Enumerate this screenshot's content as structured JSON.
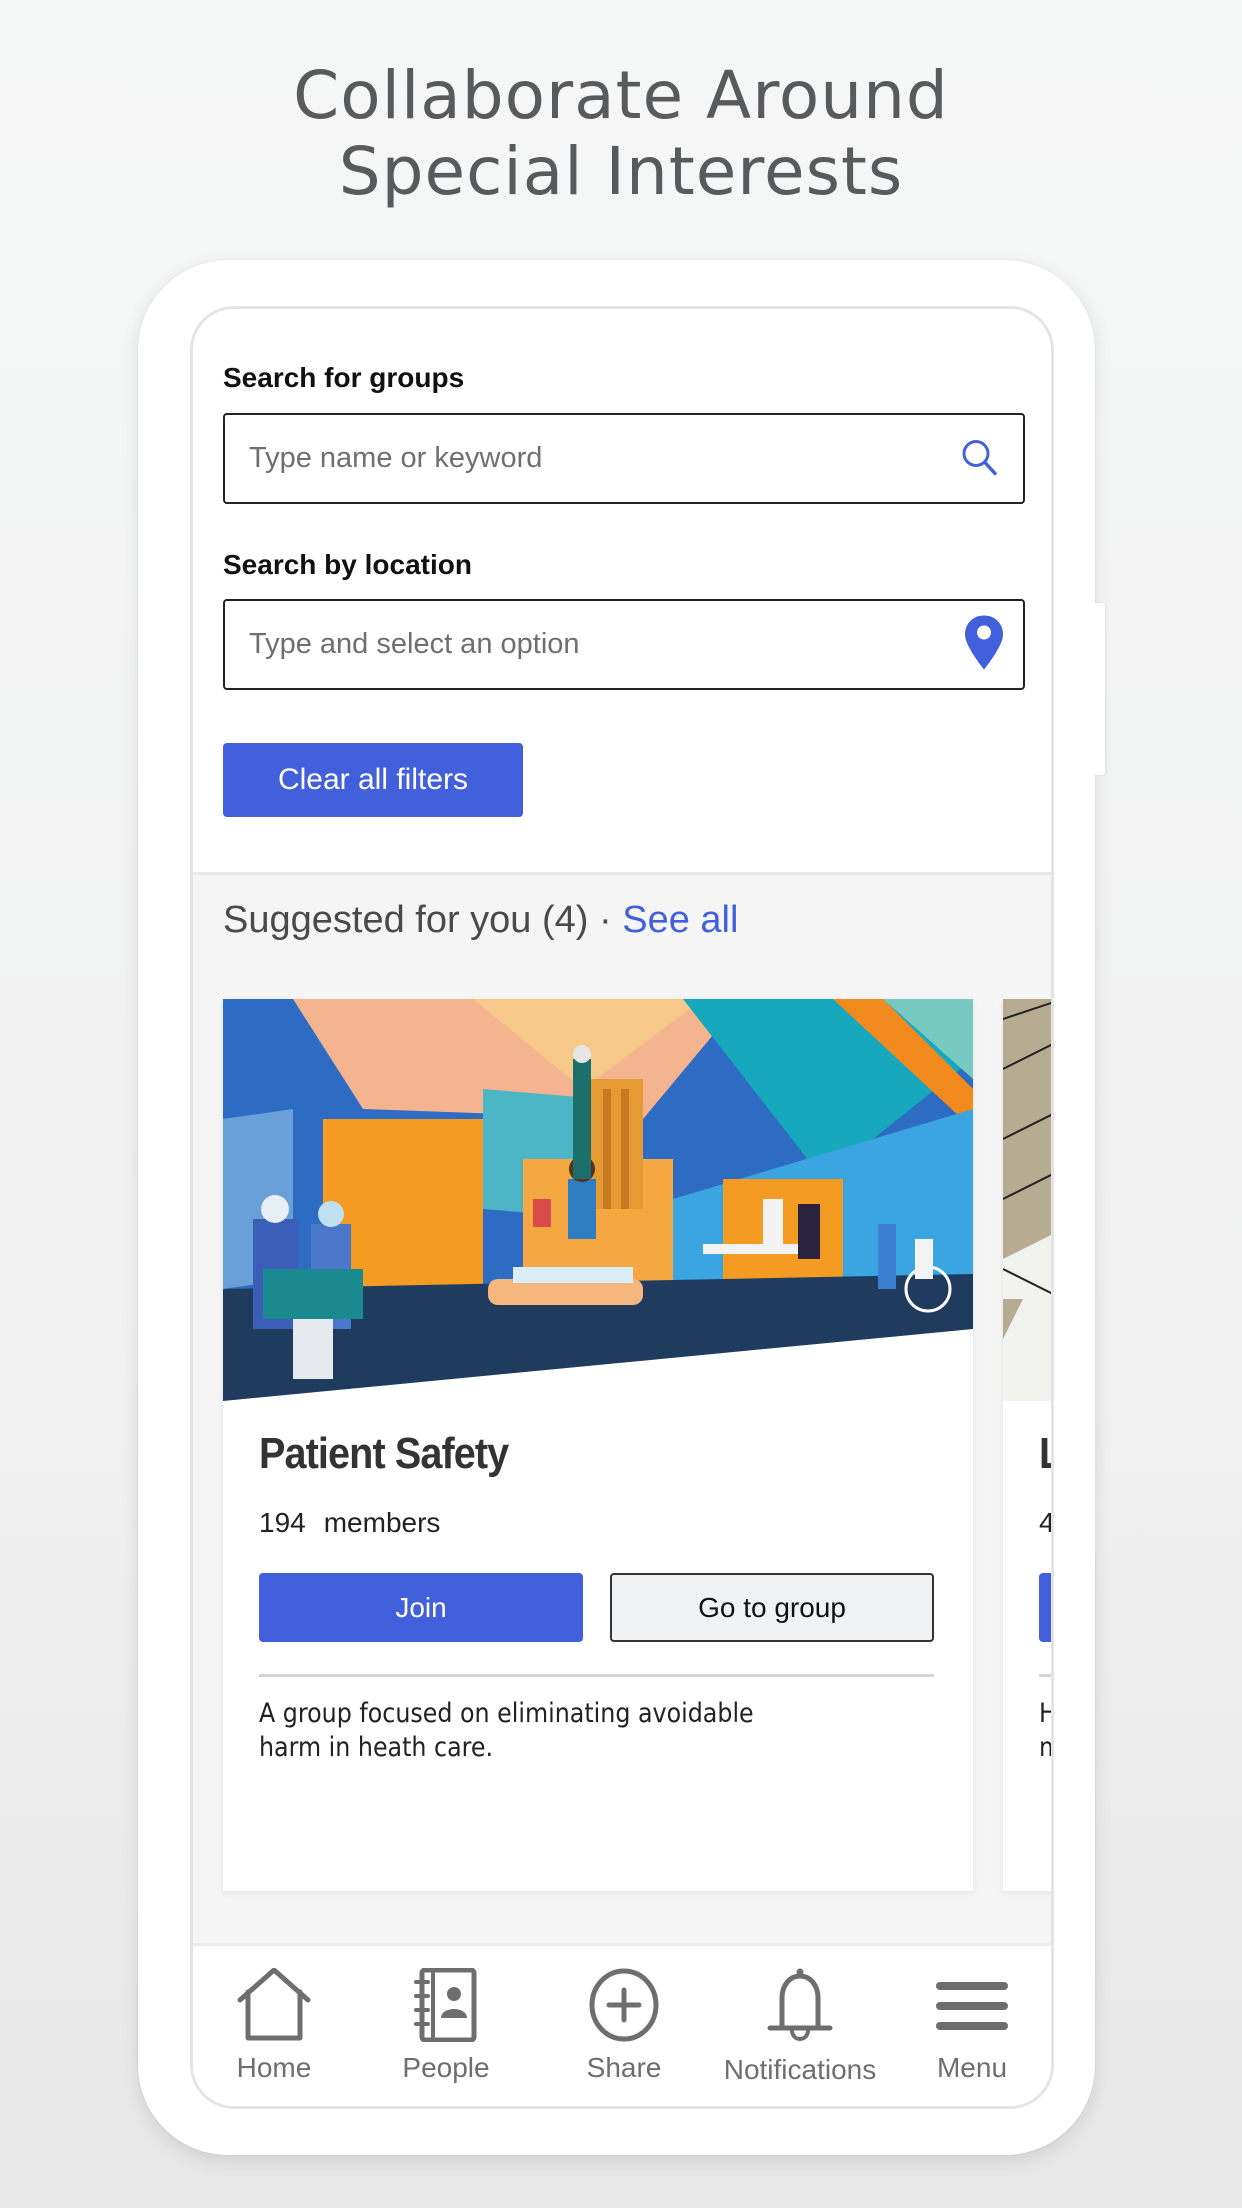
{
  "headline": {
    "line1": "Collaborate Around",
    "line2": "Special Interests"
  },
  "filters": {
    "group_search_label": "Search for groups",
    "group_search_placeholder": "Type name or keyword",
    "group_search_value": "",
    "location_label": "Search by location",
    "location_placeholder": "Type and select an option",
    "location_value": "",
    "clear_button": "Clear all filters"
  },
  "suggested": {
    "title": "Suggested for you (4)",
    "separator": " · ",
    "see_all": "See all",
    "cards": [
      {
        "name": "Patient Safety",
        "member_count": "194",
        "member_label": "members",
        "join_label": "Join",
        "goto_label": "Go to group",
        "description": "A group focused on eliminating avoidable harm in heath care.",
        "image": "hospital-illustration"
      },
      {
        "name": "L",
        "member_count": "4",
        "member_label": "",
        "join_label": "",
        "goto_label": "",
        "description": "H m",
        "image": "architecture-photo"
      }
    ]
  },
  "tabbar": {
    "items": [
      {
        "label": "Home",
        "icon": "home-icon"
      },
      {
        "label": "People",
        "icon": "address-book-icon"
      },
      {
        "label": "Share",
        "icon": "plus-circle-icon"
      },
      {
        "label": "Notifications",
        "icon": "bell-icon"
      },
      {
        "label": "Menu",
        "icon": "hamburger-icon"
      }
    ]
  },
  "colors": {
    "accent": "#4360dc",
    "text_gray": "#595a5c",
    "tab_gray": "#6e6e6e"
  }
}
